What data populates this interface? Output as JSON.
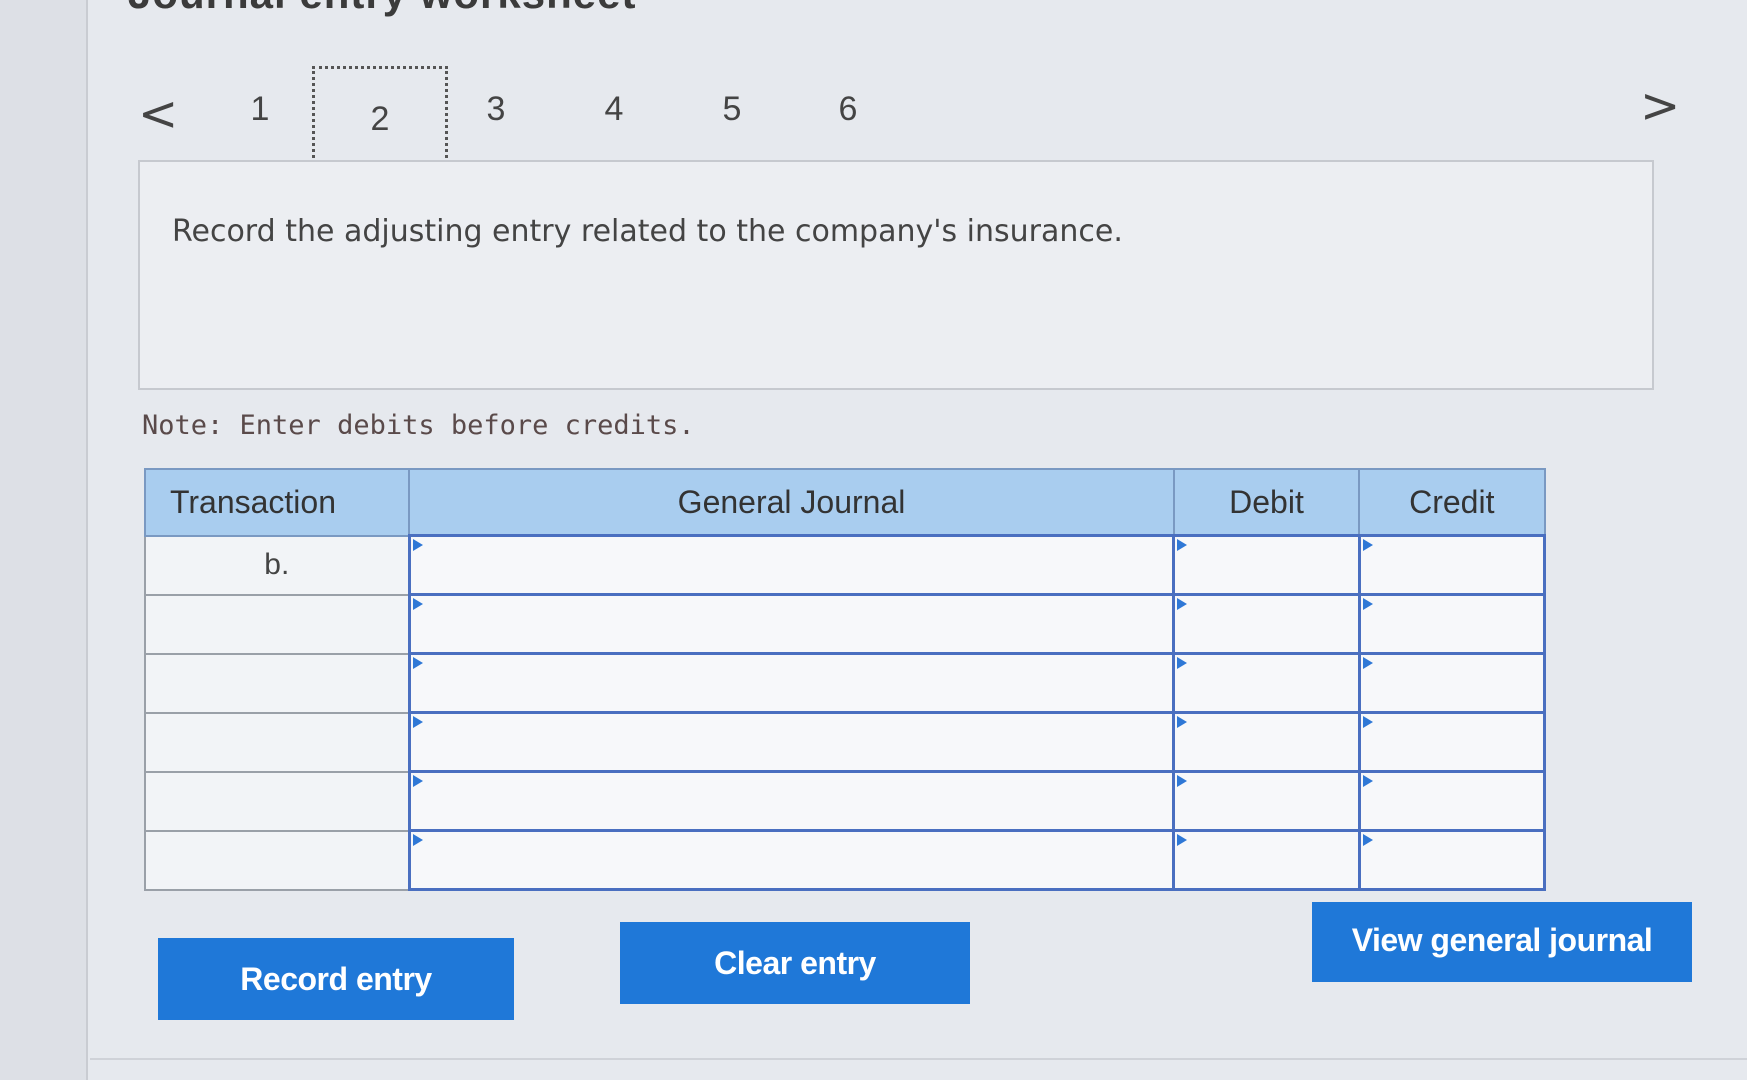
{
  "title": "Journal entry worksheet",
  "pager": {
    "prev_symbol": "<",
    "next_symbol": ">",
    "pages": [
      "1",
      "2",
      "3",
      "4",
      "5",
      "6"
    ],
    "active_page": "2"
  },
  "prompt": {
    "text": "Record the adjusting entry related to the company's insurance."
  },
  "note": "Note: Enter debits before credits.",
  "journal": {
    "headers": {
      "transaction": "Transaction",
      "general_journal": "General Journal",
      "debit": "Debit",
      "credit": "Credit"
    },
    "rows": [
      {
        "transaction": "b.",
        "account": "",
        "debit": "",
        "credit": ""
      },
      {
        "transaction": "",
        "account": "",
        "debit": "",
        "credit": ""
      },
      {
        "transaction": "",
        "account": "",
        "debit": "",
        "credit": ""
      },
      {
        "transaction": "",
        "account": "",
        "debit": "",
        "credit": ""
      },
      {
        "transaction": "",
        "account": "",
        "debit": "",
        "credit": ""
      },
      {
        "transaction": "",
        "account": "",
        "debit": "",
        "credit": ""
      }
    ]
  },
  "buttons": {
    "record": "Record entry",
    "clear": "Clear entry",
    "view": "View general journal"
  },
  "colors": {
    "button_blue": "#1f78d8",
    "header_blue": "#a9cdef",
    "input_border": "#4a6fc0"
  }
}
